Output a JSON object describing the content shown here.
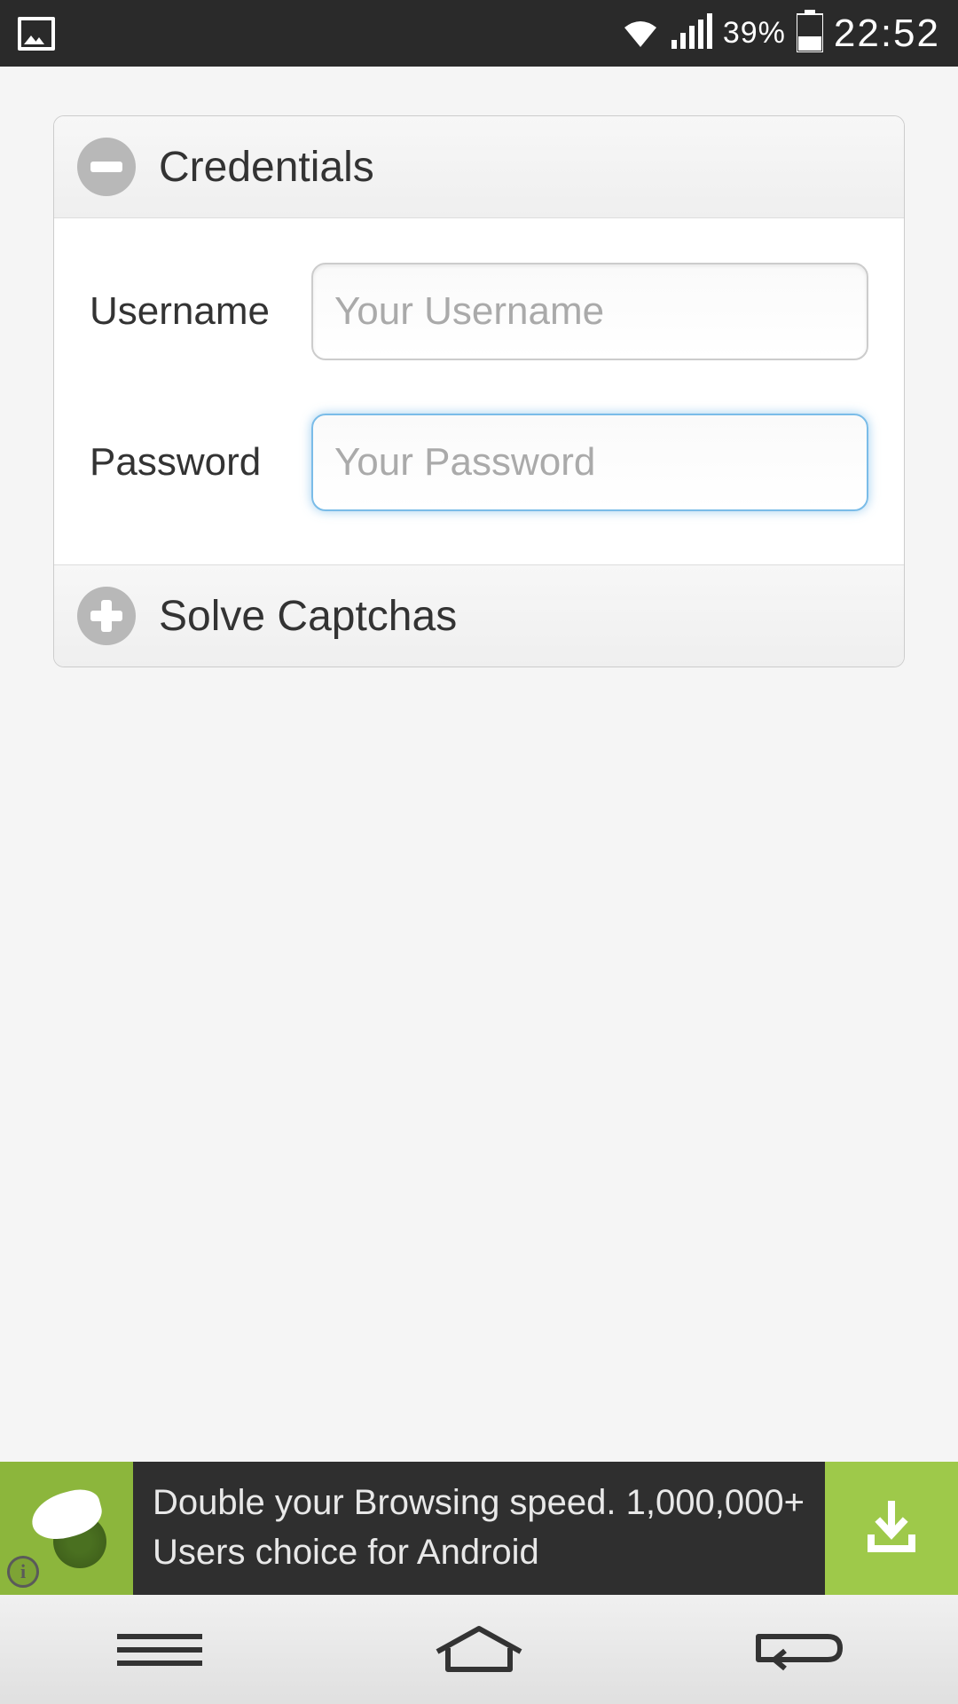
{
  "status_bar": {
    "battery_pct": "39%",
    "time": "22:52"
  },
  "accordion": {
    "credentials": {
      "title": "Credentials",
      "expanded": true,
      "fields": {
        "username": {
          "label": "Username",
          "placeholder": "Your Username",
          "value": ""
        },
        "password": {
          "label": "Password",
          "placeholder": "Your Password",
          "value": ""
        }
      }
    },
    "captchas": {
      "title": "Solve Captchas",
      "expanded": false
    }
  },
  "ad": {
    "text": "Double your Browsing speed. 1,000,000+ Users choice for Android"
  }
}
